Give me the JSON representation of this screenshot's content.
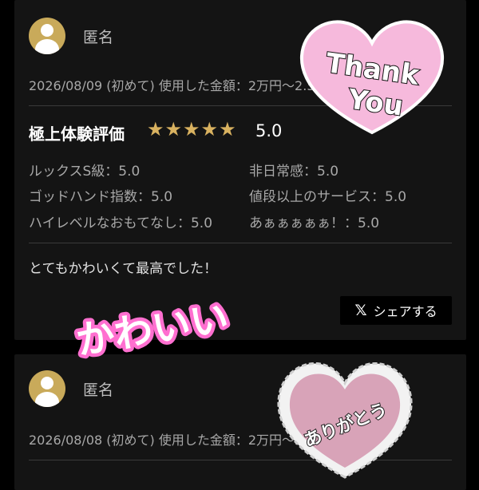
{
  "reviews": [
    {
      "user": "匿名",
      "meta": "2026/08/09 (初めて) 使用した金額：2万円〜2.5万円以内",
      "rating_title": "極上体験評価",
      "stars": "★★★★★",
      "score": "5.0",
      "sub_ratings": [
        "ルックスS級：5.0",
        "非日常感：5.0",
        "ゴッドハンド指数：5.0",
        "値段以上のサービス：5.0",
        "ハイレベルなおもてなし：5.0",
        "あぁぁぁぁぁ！：5.0"
      ],
      "comment": "とてもかわいくて最高でした！",
      "share_label": "シェアする"
    },
    {
      "user": "匿名",
      "meta": "2026/08/08 (初めて) 使用した金額：2万円〜2.5万円以内"
    }
  ],
  "stickers": {
    "thank_you_line1": "Thank",
    "thank_you_line2": "You",
    "kawaii": "かわいい",
    "arigatou": "ありがとう"
  },
  "colors": {
    "accent_gold": "#d9b260",
    "sticker_pink": "#f6b9dc",
    "kawaii_glow": "#ff6fd0"
  }
}
